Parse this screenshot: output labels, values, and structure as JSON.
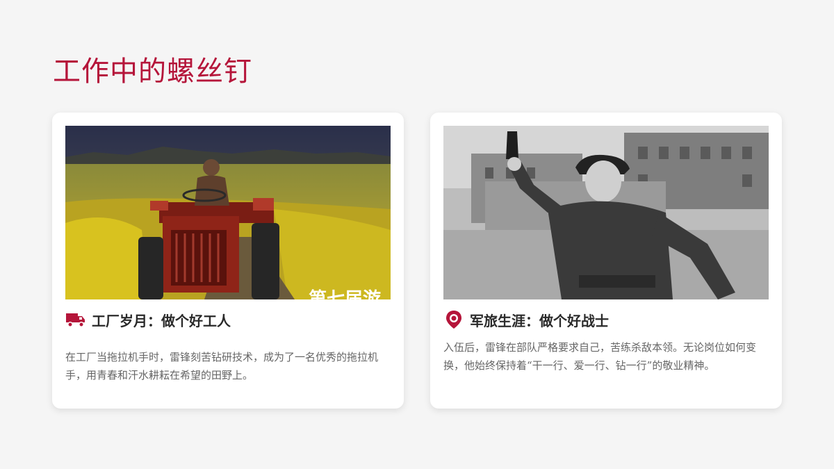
{
  "page": {
    "title": "工作中的螺丝钉"
  },
  "colors": {
    "accent": "#b5153a",
    "background": "#f5f5f5",
    "card": "#ffffff",
    "heading_text": "#2a2a2a",
    "body_text": "#666666"
  },
  "cards": [
    {
      "icon": "truck-icon",
      "heading": "工厂岁月：做个好工人",
      "body": "在工厂当拖拉机手时，雷锋刻苦钻研技术，成为了一名优秀的拖拉机手，用青春和汗水耕耘在希望的田野上。",
      "image": "tractor-photo"
    },
    {
      "icon": "location-pin-icon",
      "heading": "军旅生涯：做个好战士",
      "body": "入伍后，雷锋在部队严格要求自己，苦练杀敌本领。无论岗位如何变换，他始终保持着“干一行、爱一行、钻一行”的敬业精神。",
      "image": "soldier-photo"
    }
  ]
}
